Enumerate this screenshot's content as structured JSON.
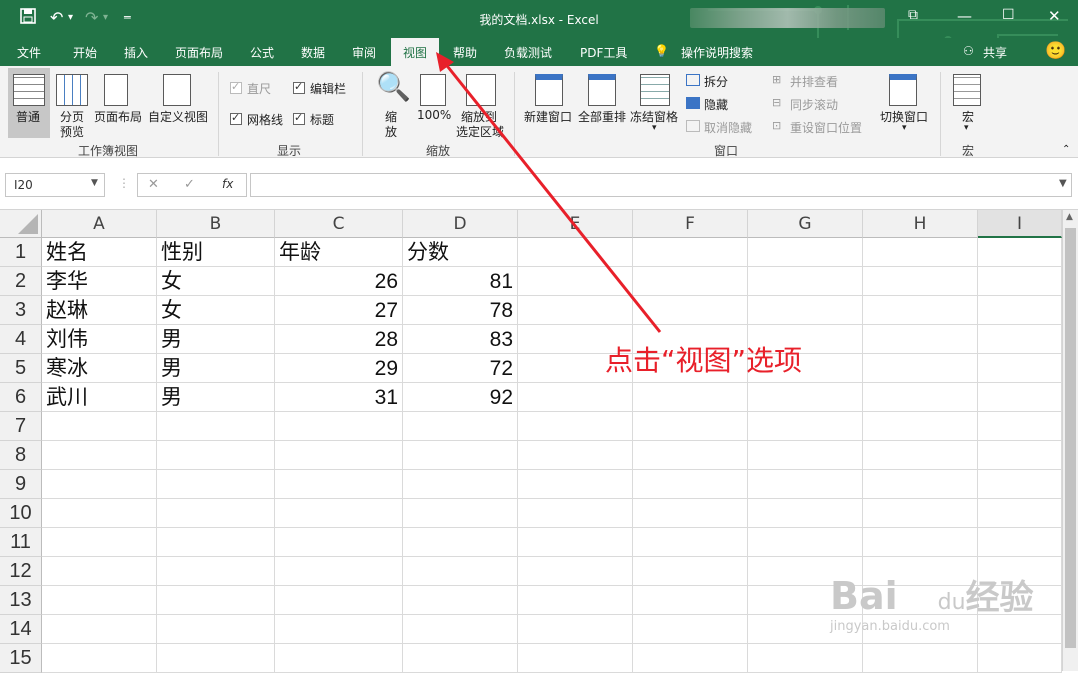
{
  "titlebar": {
    "title": "我的文档.xlsx  -  Excel"
  },
  "tabs": [
    "文件",
    "开始",
    "插入",
    "页面布局",
    "公式",
    "数据",
    "审阅",
    "视图",
    "帮助",
    "负载测试",
    "PDF工具",
    "操作说明搜索"
  ],
  "share": "共享",
  "ribbon": {
    "workbook_views": {
      "normal": "普通",
      "page_break_1": "分页",
      "page_break_2": "预览",
      "page_layout": "页面布局",
      "custom": "自定义视图",
      "group": "工作簿视图"
    },
    "show": {
      "ruler": "直尺",
      "gridlines": "网格线",
      "formula_bar": "编辑栏",
      "headings": "标题",
      "group": "显示"
    },
    "zoom": {
      "zoom_1": "缩",
      "zoom_2": "放",
      "hundred": "100%",
      "sel_1": "缩放到",
      "sel_2": "选定区域",
      "group": "缩放"
    },
    "window": {
      "new": "新建窗口",
      "arrange": "全部重排",
      "freeze": "冻结窗格",
      "split": "拆分",
      "hide": "隐藏",
      "unhide": "取消隐藏",
      "side": "并排查看",
      "sync": "同步滚动",
      "reset": "重设窗口位置",
      "switch": "切换窗口",
      "group": "窗口"
    },
    "macros": {
      "label": "宏",
      "group": "宏"
    }
  },
  "formula": {
    "namebox": "I20",
    "fx": "fx"
  },
  "columns": [
    "A",
    "B",
    "C",
    "D",
    "E",
    "F",
    "G",
    "H",
    "I"
  ],
  "rows": [
    "1",
    "2",
    "3",
    "4",
    "5",
    "6",
    "7",
    "8",
    "9",
    "10",
    "11",
    "12",
    "13",
    "14",
    "15"
  ],
  "table": {
    "header": [
      "姓名",
      "性别",
      "年龄",
      "分数"
    ],
    "data": [
      [
        "李华",
        "女",
        "26",
        "81"
      ],
      [
        "赵琳",
        "女",
        "27",
        "78"
      ],
      [
        "刘伟",
        "男",
        "28",
        "83"
      ],
      [
        "寒冰",
        "男",
        "29",
        "72"
      ],
      [
        "武川",
        "男",
        "31",
        "92"
      ]
    ]
  },
  "annotation": "点击“视图”选项",
  "watermark": {
    "line1": "Bai",
    "line2": "du",
    "line3": "经验",
    "line4": "jingyan.baidu.com"
  },
  "colors": {
    "excel_green": "#217346",
    "arrow_red": "#e8202a"
  }
}
